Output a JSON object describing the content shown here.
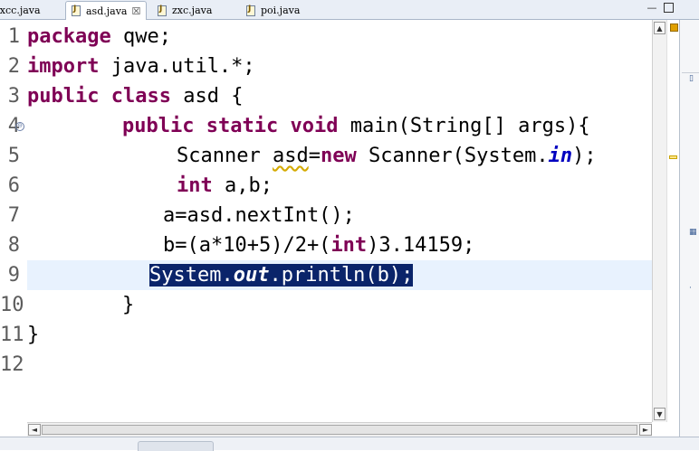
{
  "tabs": [
    {
      "label": "zxcc.java",
      "active": false
    },
    {
      "label": "asd.java",
      "active": true
    },
    {
      "label": "zxc.java",
      "active": false
    },
    {
      "label": "poi.java",
      "active": false
    }
  ],
  "tab_close_glyph": "☒",
  "window_buttons": {
    "minimize": "—",
    "maximize": ""
  },
  "line_numbers": [
    "1",
    "2",
    "3",
    "4",
    "5",
    "6",
    "7",
    "8",
    "9",
    "10",
    "11",
    "12"
  ],
  "code": {
    "l1": {
      "kw": "package",
      "rest": " qwe;"
    },
    "l2": {
      "kw": "import",
      "rest": " java.util.*;"
    },
    "l3": {
      "kw1": "public",
      "kw2": "class",
      "rest": " asd {"
    },
    "l4": {
      "kw1": "public",
      "kw2": "static",
      "kw3": "void",
      "rest": " main(String[] args){"
    },
    "l5": {
      "pre": "Scanner ",
      "var": "asd",
      "eq": "=",
      "kw": "new",
      "mid": " Scanner(System.",
      "fld": "in",
      "post": ");"
    },
    "l6": {
      "kw": "int",
      "rest": " a,b;"
    },
    "l7": {
      "text": "a=asd.nextInt();"
    },
    "l8": {
      "pre": "b=(a*10+5)/2+(",
      "kw": "int",
      "post": ")3.14159;"
    },
    "l9": {
      "pre": "System.",
      "fld": "out",
      "post": ".println(b);"
    },
    "l10": {
      "text": "}"
    },
    "l11": {
      "text": "}"
    }
  },
  "scroll": {
    "up": "▲",
    "down": "▼",
    "left": "◄",
    "right": "►"
  },
  "colors": {
    "keyword": "#7f0055",
    "field": "#0000c0",
    "selection": "#0a246a",
    "current_line": "#e8f2fe"
  }
}
